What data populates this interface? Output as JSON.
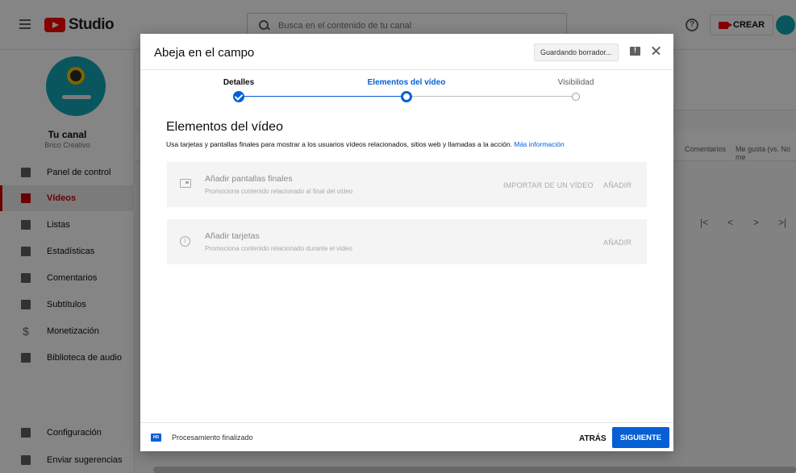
{
  "app": {
    "logo_text": "Studio",
    "search_placeholder": "Busca en el contenido de tu canal",
    "help_glyph": "?",
    "create_label": "CREAR"
  },
  "sidebar": {
    "channel_name": "Tu canal",
    "channel_sub": "Brico Creativo",
    "items": [
      {
        "label": "Panel de control"
      },
      {
        "label": "Vídeos"
      },
      {
        "label": "Listas"
      },
      {
        "label": "Estadísticas"
      },
      {
        "label": "Comentarios"
      },
      {
        "label": "Subtítulos"
      },
      {
        "label": "Monetización"
      },
      {
        "label": "Biblioteca de audio"
      },
      {
        "label": "Configuración"
      },
      {
        "label": "Enviar sugerencias"
      }
    ]
  },
  "background": {
    "col_comments": "Comentarios",
    "col_likes": "Me gusta (vs. No me",
    "pager": [
      "|<",
      "<",
      ">",
      ">|"
    ]
  },
  "dialog": {
    "title": "Abeja en el campo",
    "saving_badge": "Guardando borrador...",
    "steps": [
      {
        "label": "Detalles",
        "state": "done"
      },
      {
        "label": "Elementos del vídeo",
        "state": "current"
      },
      {
        "label": "Visibilidad",
        "state": "pending"
      }
    ],
    "section_title": "Elementos del vídeo",
    "section_desc": "Usa tarjetas y pantallas finales para mostrar a los usuarios vídeos relacionados, sitios web y llamadas a la acción.",
    "more_link": "Más información",
    "cards": [
      {
        "title": "Añadir pantallas finales",
        "subtitle": "Promociona contenido relacionado al final del vídeo",
        "import_label": "IMPORTAR DE UN VÍDEO",
        "add_label": "AÑADIR"
      },
      {
        "title": "Añadir tarjetas",
        "subtitle": "Promociona contenido relacionado durante el vídeo",
        "add_label": "AÑADIR"
      }
    ],
    "footer": {
      "hd_badge": "HD",
      "processing": "Procesamiento finalizado",
      "back_label": "ATRÁS",
      "next_label": "SIGUIENTE"
    }
  },
  "colors": {
    "accent_blue": "#065fd4",
    "youtube_red": "#ff0000",
    "active_nav_red": "#cc0000"
  }
}
